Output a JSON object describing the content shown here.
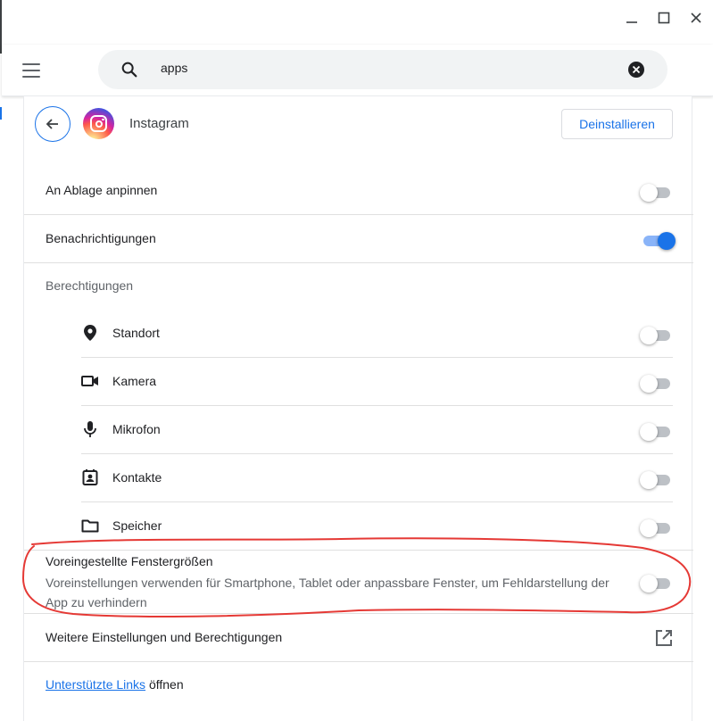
{
  "window_controls": {
    "minimize_glyph": "—",
    "maximize_glyph": "☐",
    "close_glyph": "✕"
  },
  "search": {
    "value": "apps",
    "icon": "search-icon",
    "clear_icon": "clear-icon"
  },
  "app": {
    "name": "Instagram",
    "icon": "instagram-logo",
    "uninstall_label": "Deinstallieren"
  },
  "settings": {
    "pin_shelf": {
      "label": "An Ablage anpinnen",
      "enabled": false
    },
    "notifications": {
      "label": "Benachrichtigungen",
      "enabled": true
    }
  },
  "permissions": {
    "title": "Berechtigungen",
    "items": [
      {
        "label": "Standort",
        "icon": "location-pin-icon",
        "enabled": false
      },
      {
        "label": "Kamera",
        "icon": "video-camera-icon",
        "enabled": false
      },
      {
        "label": "Mikrofon",
        "icon": "microphone-icon",
        "enabled": false
      },
      {
        "label": "Kontakte",
        "icon": "contacts-icon",
        "enabled": false
      },
      {
        "label": "Speicher",
        "icon": "folder-icon",
        "enabled": false
      }
    ]
  },
  "window_size": {
    "title": "Voreingestellte Fenstergrößen",
    "description": "Voreinstellungen verwenden für Smartphone, Tablet oder anpassbare Fenster, um Fehldarstellung der App zu verhindern",
    "enabled": false
  },
  "more_settings": {
    "label": "Weitere Einstellungen und Berechtigungen",
    "icon": "open-in-new-icon"
  },
  "supported_links": {
    "link_text": "Unterstützte Links",
    "suffix": " öffnen"
  },
  "colors": {
    "accent": "#1a73e8",
    "annotation": "#e53935"
  }
}
